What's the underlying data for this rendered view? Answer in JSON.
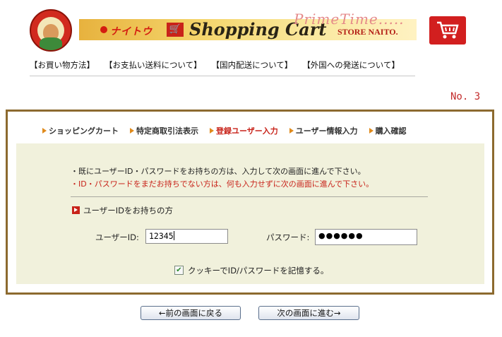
{
  "header": {
    "banner_sub": "ナイトウ",
    "banner_title": "Shopping Cart",
    "prime_time": "PrimeTime.....",
    "store_name": "STORE NAITO.",
    "cart_button_icon": "shopping-cart-icon"
  },
  "top_nav": [
    "【お買い物方法】",
    "【お支払い送料について】",
    "【国内配送について】",
    "【外国への発送について】"
  ],
  "step_number": "No. 3",
  "steps": [
    {
      "label": "ショッピングカート",
      "active": false
    },
    {
      "label": "特定商取引法表示",
      "active": false
    },
    {
      "label": "登録ユーザー入力",
      "active": true
    },
    {
      "label": "ユーザー情報入力",
      "active": false
    },
    {
      "label": "購入確認",
      "active": false
    }
  ],
  "form": {
    "notice_1": "・既にユーザーID・パスワードをお持ちの方は、入力して次の画面に進んで下さい。",
    "notice_2": "・ID・パスワードをまだお持ちでない方は、何も入力せずに次の画面に進んで下さい。",
    "section_label": "ユーザーIDをお持ちの方",
    "userid_label": "ユーザーID:",
    "userid_value": "12345",
    "password_label": "パスワード:",
    "password_value": "●●●●●●",
    "cookie_label": "クッキーでID/パスワードを記憶する。",
    "cookie_checked": true
  },
  "buttons": {
    "prev": "←前の画面に戻る",
    "next": "次の画面に進む→"
  },
  "colors": {
    "frame_border": "#8c6a2f",
    "panel_bg": "#f1f1dc",
    "accent_red": "#c8231a",
    "step_arrow": "#e08b1d"
  }
}
